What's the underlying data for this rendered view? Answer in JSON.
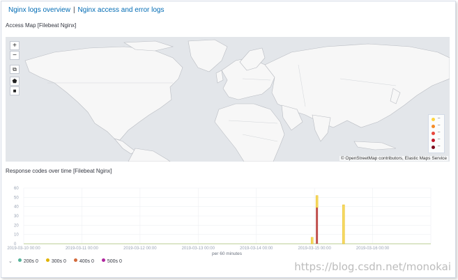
{
  "header": {
    "link_overview": "Nginx logs overview",
    "separator": "|",
    "link_access": "Nginx access and error logs"
  },
  "map_panel": {
    "title": "Access Map [Filebeat Nginx]",
    "controls": [
      {
        "name": "zoom-in-button",
        "icon": "+"
      },
      {
        "name": "zoom-out-button",
        "icon": "−"
      },
      {
        "name": "fit-bounds-button",
        "icon": "⧉"
      },
      {
        "name": "draw-polygon-button",
        "icon": "⬟"
      },
      {
        "name": "draw-rectangle-button",
        "icon": "■"
      }
    ],
    "legend": [
      {
        "label": "–",
        "color": "#fdd441"
      },
      {
        "label": "–",
        "color": "#f58b27"
      },
      {
        "label": "–",
        "color": "#e8473c"
      },
      {
        "label": "–",
        "color": "#c0182a"
      },
      {
        "label": "–",
        "color": "#7c0a1d"
      }
    ],
    "attribution": "© OpenStreetMap contributors, Elastic Maps Service"
  },
  "chart_panel": {
    "title": "Response codes over time [Filebeat Nginx]",
    "xaxis_label": "per 60 minutes",
    "watermark": "https://blog.csdn.net/monokai"
  },
  "chart_data": {
    "type": "bar",
    "stacked": true,
    "xlabel": "per 60 minutes",
    "ylabel": "",
    "ylim": [
      0,
      60
    ],
    "yticks": [
      0,
      10,
      20,
      30,
      40,
      50,
      60
    ],
    "xticks": [
      "2019-03-10 00:00",
      "2019-03-11 00:00",
      "2019-03-12 00:00",
      "2019-03-13 00:00",
      "2019-03-14 00:00",
      "2019-03-15 00:00",
      "2019-03-16 00:00"
    ],
    "x_start": "2019-03-10 00:00",
    "x_end": "2019-03-17 00:00",
    "grid": true,
    "legend_position": "bottom-left",
    "series": [
      {
        "name": "200s",
        "count_label": "0",
        "color": "#54b399"
      },
      {
        "name": "300s",
        "count_label": "0",
        "color": "#e0b300"
      },
      {
        "name": "400s",
        "count_label": "0",
        "color": "#d36a3b"
      },
      {
        "name": "500s",
        "count_label": "0",
        "color": "#b0279f"
      }
    ],
    "bars": [
      {
        "time": "2019-03-14 23:00",
        "values": {
          "200s": 0,
          "300s": 7,
          "400s": 0,
          "500s": 0
        }
      },
      {
        "time": "2019-03-15 01:00",
        "values": {
          "200s": 0,
          "300s": 13,
          "400s": 39,
          "500s": 0
        }
      },
      {
        "time": "2019-03-15 12:00",
        "values": {
          "200s": 0,
          "300s": 42,
          "400s": 0,
          "500s": 0
        }
      }
    ]
  }
}
